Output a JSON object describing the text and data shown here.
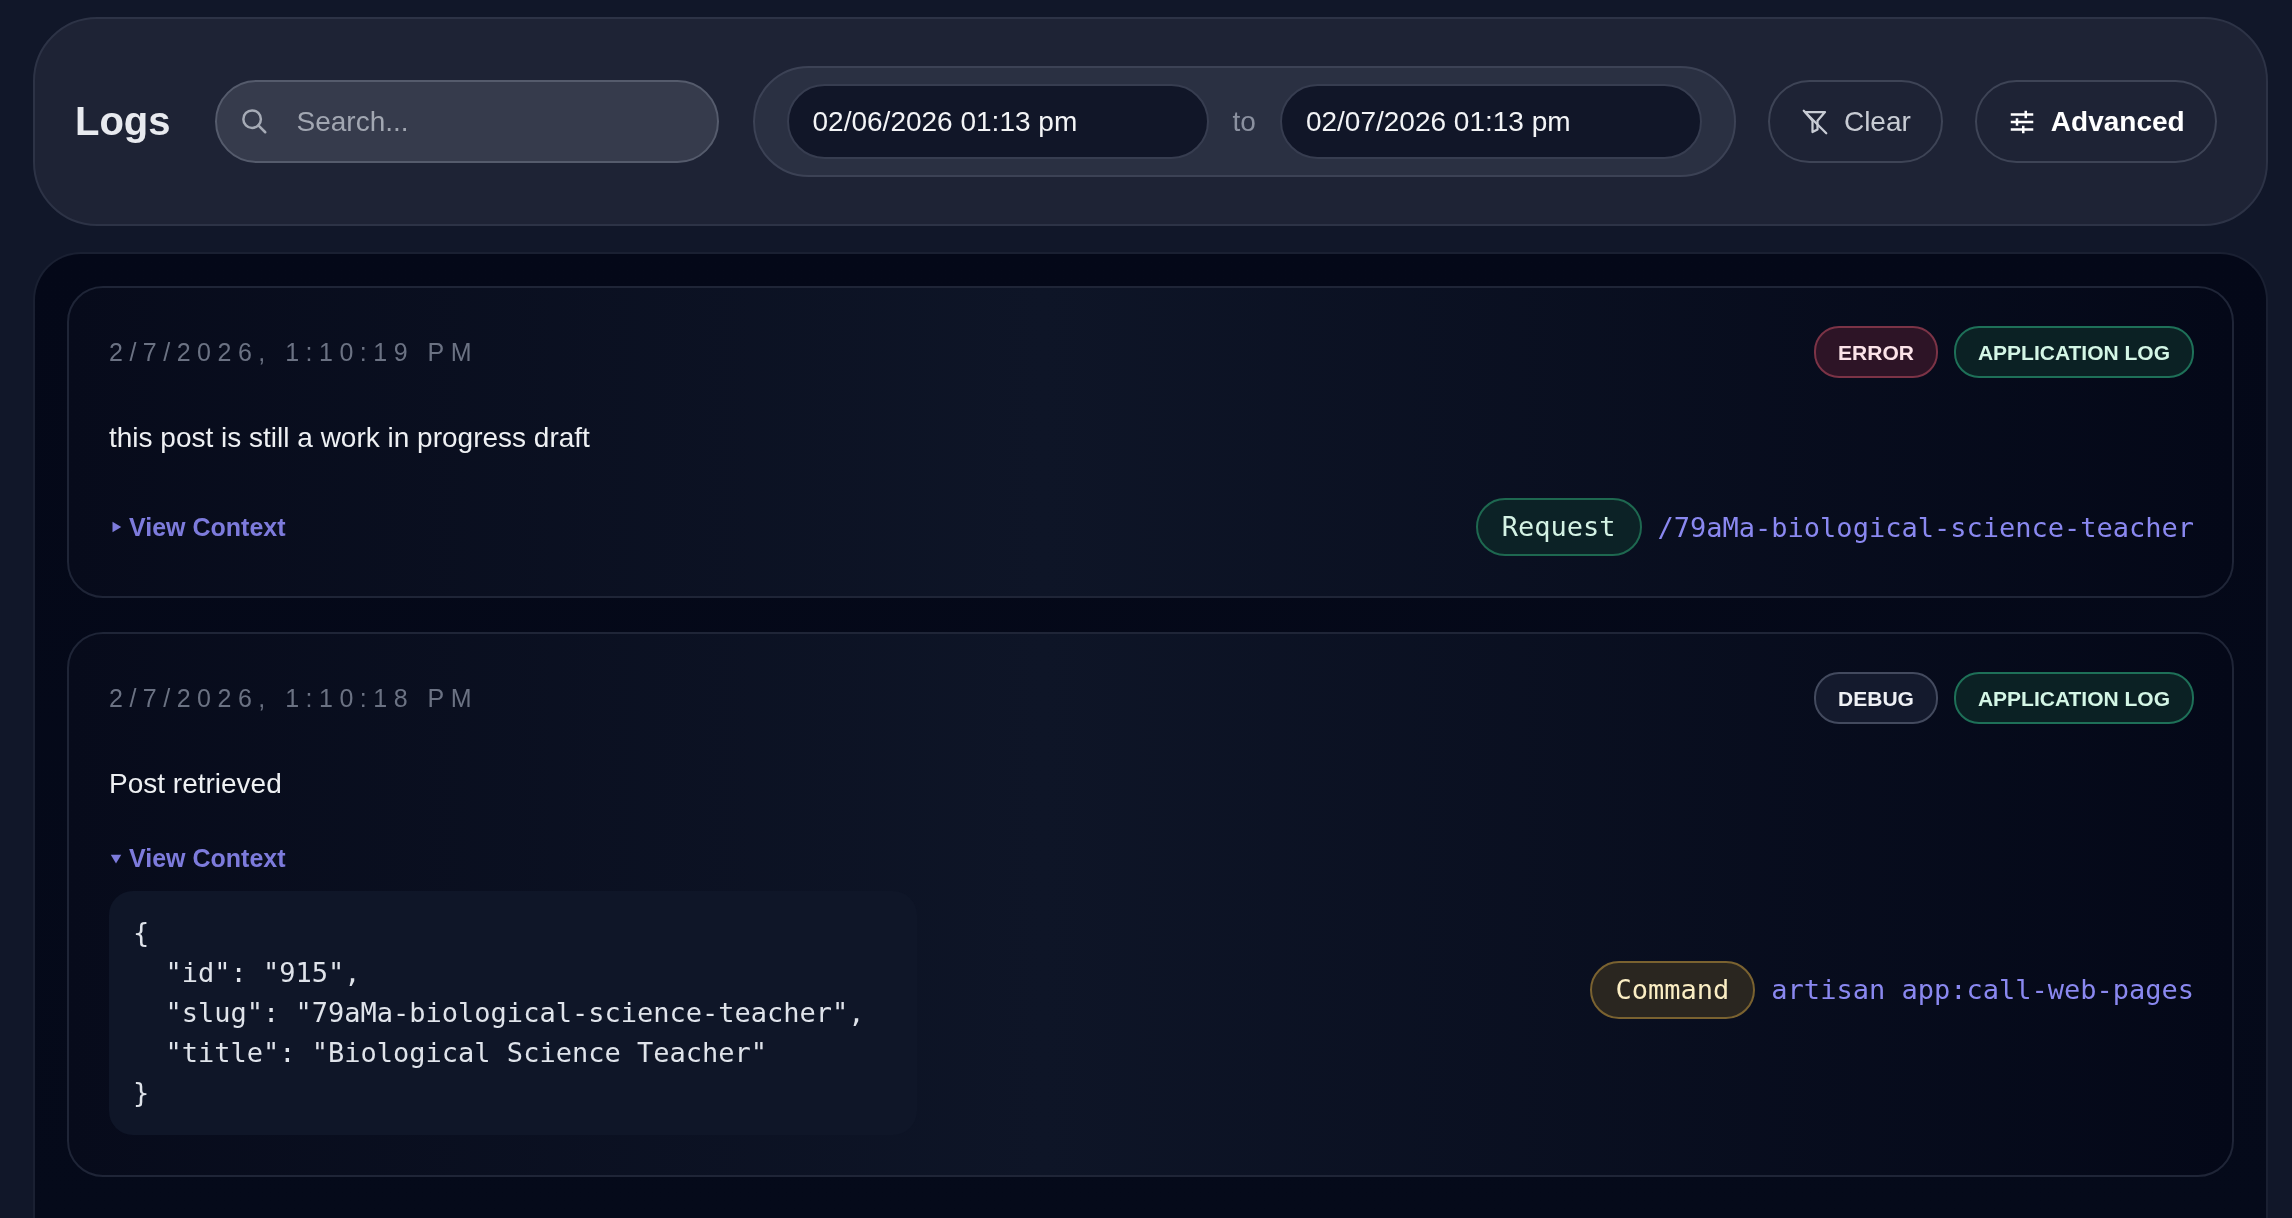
{
  "header": {
    "title": "Logs",
    "search": {
      "placeholder": "Search..."
    },
    "date_range": {
      "from": "02/06/2026 01:13 pm",
      "separator": "to",
      "to": "02/07/2026 01:13 pm"
    },
    "buttons": [
      {
        "kind": "clear",
        "label": "Clear"
      },
      {
        "kind": "advanced",
        "label": "Advanced"
      }
    ]
  },
  "entries": [
    {
      "timestamp": "2/7/2026, 1:10:19 PM",
      "badges": [
        {
          "kind": "error",
          "label": "ERROR"
        },
        {
          "kind": "channel",
          "label": "APPLICATION LOG"
        }
      ],
      "message": "this post is still a work in progress draft",
      "context": {
        "label": "View Context",
        "expanded": false
      },
      "source": {
        "kind": "request",
        "label": "Request",
        "value": "/79aMa-biological-science-teacher"
      }
    },
    {
      "timestamp": "2/7/2026, 1:10:18 PM",
      "badges": [
        {
          "kind": "debug",
          "label": "DEBUG"
        },
        {
          "kind": "channel",
          "label": "APPLICATION LOG"
        }
      ],
      "message": "Post retrieved",
      "context": {
        "label": "View Context",
        "expanded": true,
        "lines": [
          "{",
          "  \"id\": \"915\",",
          "  \"slug\": \"79aMa-biological-science-teacher\",",
          "  \"title\": \"Biological Science Teacher\"",
          "}"
        ]
      },
      "source": {
        "kind": "command",
        "label": "Command",
        "value": "artisan app:call-web-pages"
      }
    }
  ]
}
